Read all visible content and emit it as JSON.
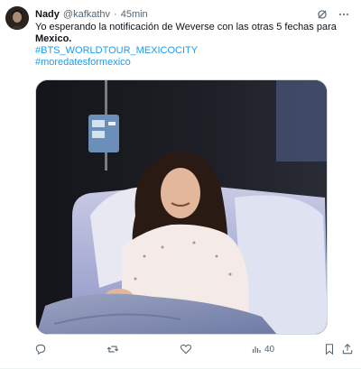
{
  "tweet": {
    "author": {
      "display_name": "Nady",
      "handle": "@kafkathv",
      "separator": "·",
      "time": "45min"
    },
    "text": {
      "line1": "Yo esperando la notificación de Weverse con las otras 5 fechas para",
      "bold": "Mexico.",
      "hashtags": [
        "#BTS_WORLDTOUR_MEXICOCITY",
        "#moredatesformexico"
      ]
    },
    "media": {
      "description_icon": "photo"
    },
    "actions": {
      "reply_icon": "reply-icon",
      "retweet_icon": "retweet-icon",
      "like_icon": "like-icon",
      "views_icon": "views-icon",
      "views_count": "40",
      "bookmark_icon": "bookmark-icon",
      "share_icon": "share-icon"
    },
    "colors": {
      "link": "#1d9bf0",
      "muted": "#536471",
      "text": "#0f1419"
    }
  }
}
